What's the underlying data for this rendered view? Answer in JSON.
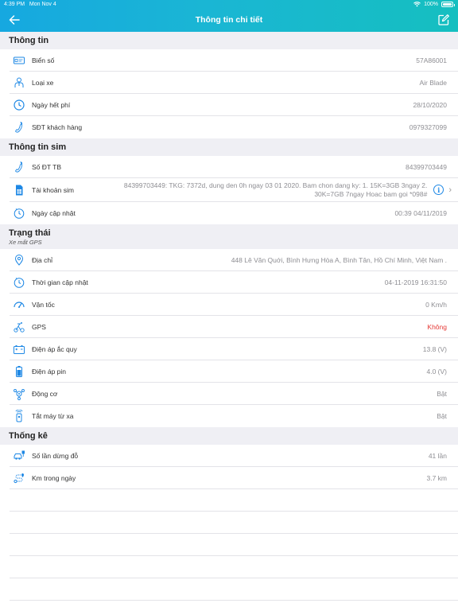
{
  "status": {
    "time": "4:39 PM",
    "date": "Mon Nov 4",
    "battery": "100%"
  },
  "nav": {
    "title": "Thông tin chi tiết"
  },
  "sections": {
    "info": {
      "title": "Thông tin",
      "plate": {
        "label": "Biển số",
        "value": "57A86001"
      },
      "vehicle_type": {
        "label": "Loại xe",
        "value": "Air Blade"
      },
      "expiry": {
        "label": "Ngày hết phí",
        "value": "28/10/2020"
      },
      "phone": {
        "label": "SĐT khách hàng",
        "value": "0979327099"
      }
    },
    "sim": {
      "title": "Thông tin sim",
      "number": {
        "label": "Số ĐT TB",
        "value": "84399703449"
      },
      "account": {
        "label": "Tài khoản sim",
        "value": "84399703449: TKG: 7372d, dung den 0h ngay 03 01 2020. Bam chon dang ky: 1. 15K=3GB 3ngay 2. 30K=7GB 7ngay Hoac bam goi *098#"
      },
      "updated": {
        "label": "Ngày cập nhật",
        "value": "00:39 04/11/2019"
      }
    },
    "state": {
      "title": "Trạng thái",
      "subtitle": "Xe mất GPS",
      "address": {
        "label": "Địa chỉ",
        "value": "448 Lê Văn Quới, Bình Hưng Hòa A, Bình Tân, Hồ Chí Minh, Việt Nam ."
      },
      "update_time": {
        "label": "Thời gian cập nhật",
        "value": "04-11-2019 16:31:50"
      },
      "speed": {
        "label": "Vận tốc",
        "value": "0 Km/h"
      },
      "gps": {
        "label": "GPS",
        "value": "Không"
      },
      "battery_voltage": {
        "label": "Điện áp ắc quy",
        "value": "13.8 (V)"
      },
      "pin_voltage": {
        "label": "Điện áp pin",
        "value": "4.0 (V)"
      },
      "engine": {
        "label": "Động cơ",
        "value": "Bật"
      },
      "remote_off": {
        "label": "Tắt máy từ xa",
        "value": "Bật"
      }
    },
    "stats": {
      "title": "Thống kê",
      "stops": {
        "label": "Số lần dừng đỗ",
        "value": "41 lần"
      },
      "km_today": {
        "label": "Km trong ngày",
        "value": "3.7 km"
      }
    }
  },
  "colors": {
    "accent": "#1e88e5",
    "header_start": "#16a8e0",
    "header_end": "#15bfc0",
    "alert": "#e53935"
  }
}
